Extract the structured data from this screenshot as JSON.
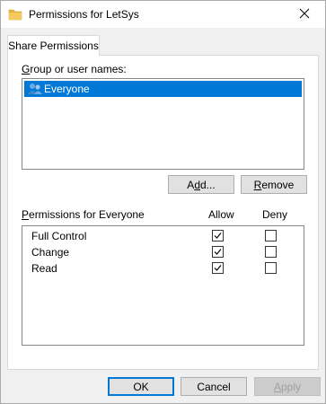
{
  "window": {
    "title": "Permissions for LetSys"
  },
  "tabs": [
    {
      "label": "Share Permissions",
      "active": true
    }
  ],
  "group_section": {
    "label_pre": "",
    "label_mnemonic": "G",
    "label_post": "roup or user names:",
    "users": [
      {
        "name": "Everyone",
        "selected": true,
        "icon": "user-group-icon"
      }
    ]
  },
  "buttons": {
    "add_pre": "A",
    "add_mnemonic": "d",
    "add_post": "d...",
    "remove_mnemonic": "R",
    "remove_post": "emove"
  },
  "permissions": {
    "label_mnemonic": "P",
    "label_post": "ermissions for Everyone",
    "allow_header": "Allow",
    "deny_header": "Deny",
    "rows": [
      {
        "name": "Full Control",
        "allow": true,
        "deny": false
      },
      {
        "name": "Change",
        "allow": true,
        "deny": false
      },
      {
        "name": "Read",
        "allow": true,
        "deny": false
      }
    ]
  },
  "footer": {
    "ok_label": "OK",
    "cancel_label": "Cancel",
    "apply_label": "Apply",
    "apply_mnemonic": "A",
    "apply_post": "pply"
  },
  "colors": {
    "selection": "#0078d7",
    "folder": "#e8b33f"
  }
}
